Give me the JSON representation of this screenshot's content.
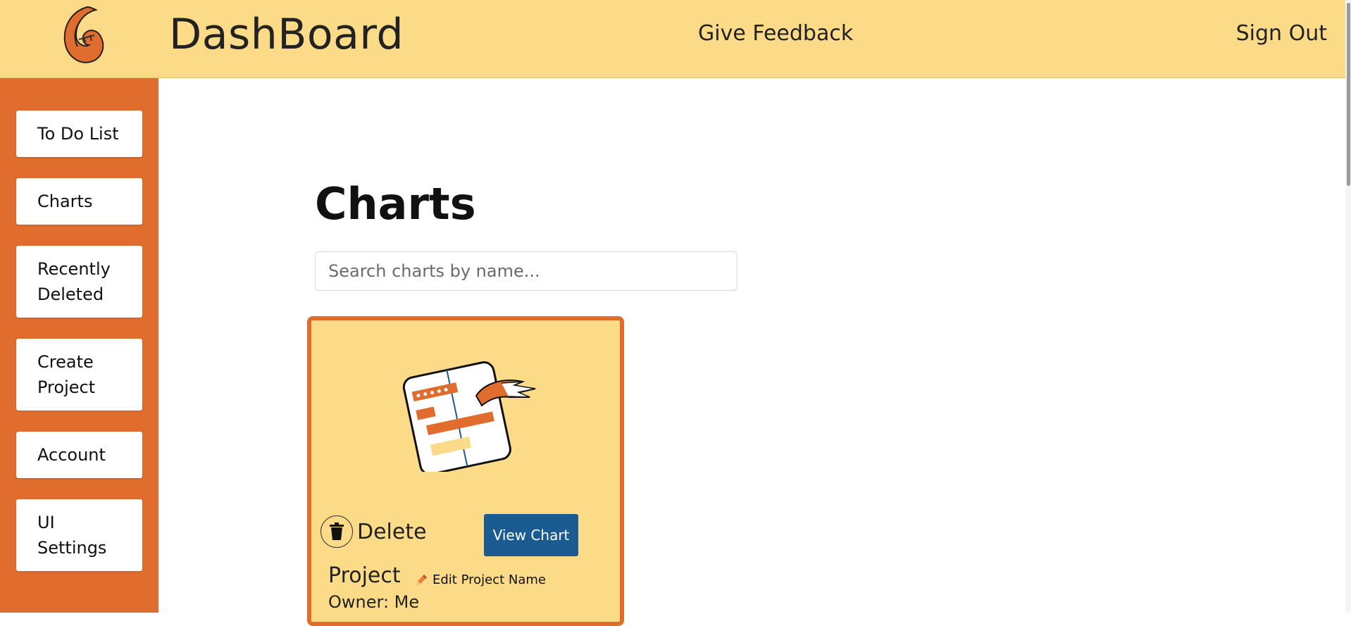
{
  "header": {
    "title": "DashBoard",
    "feedback_label": "Give Feedback",
    "signout_label": "Sign Out",
    "logo_icon": "flame-logo-icon"
  },
  "sidebar": {
    "items": [
      {
        "label": "To Do List"
      },
      {
        "label": "Charts"
      },
      {
        "label": "Recently Deleted"
      },
      {
        "label": "Create Project"
      },
      {
        "label": "Account"
      },
      {
        "label": "UI Settings"
      }
    ]
  },
  "main": {
    "title": "Charts",
    "search": {
      "placeholder": "Search charts by name...",
      "value": ""
    },
    "cards": [
      {
        "image_icon": "gantt-chart-icon",
        "delete_label": "Delete",
        "view_label": "View Chart",
        "project_name": "Project",
        "edit_label": "Edit Project Name",
        "owner": "Owner: Me"
      }
    ]
  },
  "colors": {
    "header_bg": "#fbdb88",
    "sidebar_bg": "#e06c2e",
    "card_bg": "#fbdb88",
    "card_border": "#e06c2e",
    "primary_button": "#1a5c92"
  }
}
